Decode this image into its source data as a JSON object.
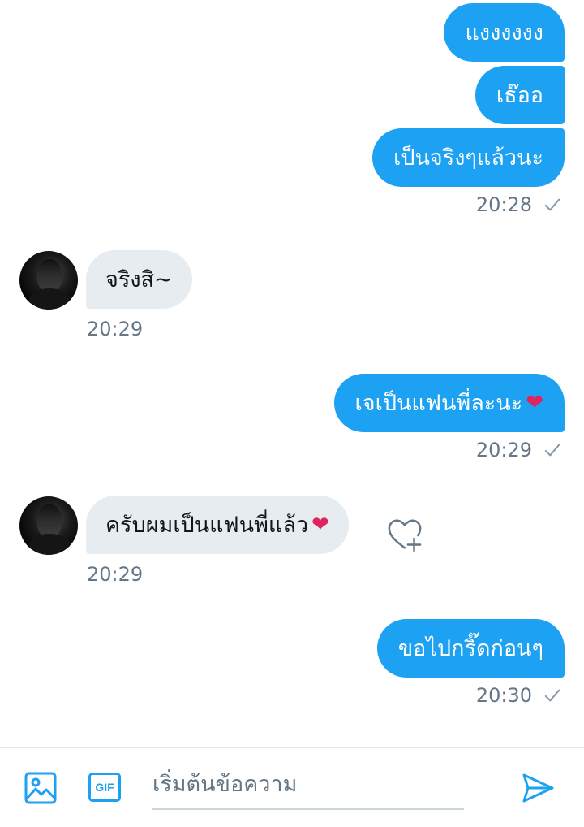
{
  "messages": {
    "m1": {
      "text": "แงงงงงง"
    },
    "m2": {
      "text": "เธ๊ออ"
    },
    "m3": {
      "text": "เป็นจริงๆแล้วนะ"
    },
    "t1": "20:28",
    "m4": {
      "text": "จริงสิ~"
    },
    "t2": "20:29",
    "m5": {
      "text": "เจเป็นแฟนพี่ละนะ",
      "emoji": "❤"
    },
    "t3": "20:29",
    "m6": {
      "text": "ครับผมเป็นแฟนพี่แล้ว",
      "emoji": "❤"
    },
    "t4": "20:29",
    "m7": {
      "text": "ขอไปกริ๊ดก่อนๆ"
    },
    "t5": "20:30"
  },
  "composer": {
    "gif_label": "GIF",
    "placeholder": "เริ่มต้นข้อความ"
  },
  "colors": {
    "accent": "#1da1f2",
    "incoming_bubble": "#e6ecf0",
    "timestamp": "#657786",
    "heart": "#e0245e"
  },
  "icons": {
    "media": "image-icon",
    "gif": "gif-icon",
    "send": "send-icon",
    "read": "checkmark-icon",
    "like": "heart-plus-icon"
  }
}
